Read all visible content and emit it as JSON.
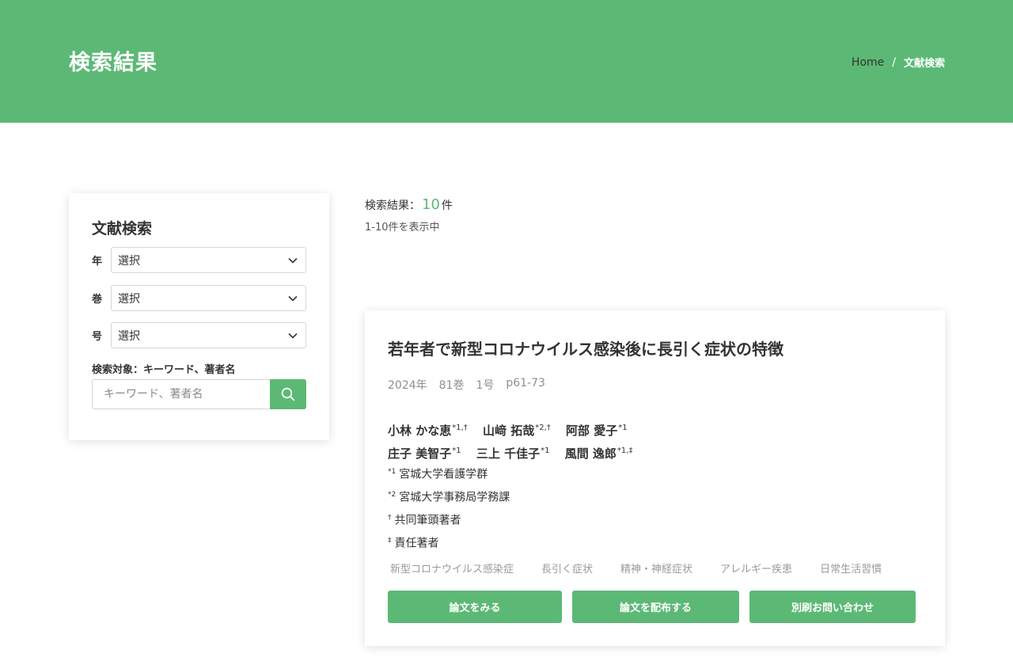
{
  "header": {
    "title": "検索結果",
    "breadcrumb": {
      "home": "Home",
      "separator": "/",
      "current": "文献検索"
    }
  },
  "sidebar": {
    "title": "文献検索",
    "filters": [
      {
        "label": "年",
        "value": "選択"
      },
      {
        "label": "巻",
        "value": "選択"
      },
      {
        "label": "号",
        "value": "選択"
      }
    ],
    "search_target_label": "検索対象：キーワード、著者名",
    "search_placeholder": "キーワード、著者名",
    "search_icon": "search-icon"
  },
  "results": {
    "summary_prefix": "検索結果：",
    "count": "10",
    "summary_suffix": "件",
    "range_text": "1-10件を表示中"
  },
  "article": {
    "title": "若年者で新型コロナウイルス感染後に長引く症状の特徴",
    "meta": {
      "year": "2024年",
      "volume": "81巻",
      "issue": "1号",
      "pages": "p61-73"
    },
    "authors": [
      [
        {
          "name": "小林 かな恵",
          "marks": "*1,†"
        },
        {
          "name": "山﨑 拓哉",
          "marks": "*2,†"
        },
        {
          "name": "阿部 愛子",
          "marks": "*1"
        }
      ],
      [
        {
          "name": "庄子 美智子",
          "marks": "*1"
        },
        {
          "name": "三上 千佳子",
          "marks": "*1"
        },
        {
          "name": "風間 逸郎",
          "marks": "*1,‡"
        }
      ]
    ],
    "affiliations": [
      {
        "mark": "*1",
        "text": "宮城大学看護学群"
      },
      {
        "mark": "*2",
        "text": "宮城大学事務局学務課"
      },
      {
        "mark": "†",
        "text": "共同筆頭著者"
      },
      {
        "mark": "‡",
        "text": "責任著者"
      }
    ],
    "keywords": [
      "新型コロナウイルス感染症",
      "長引く症状",
      "精神・神経症状",
      "アレルギー疾患",
      "日常生活習慣"
    ],
    "actions": {
      "view": "論文をみる",
      "distribute": "論文を配布する",
      "reprint": "別刷お問い合わせ"
    }
  },
  "colors": {
    "accent": "#5cb975",
    "text": "#333333",
    "muted": "#8f8f8f"
  }
}
